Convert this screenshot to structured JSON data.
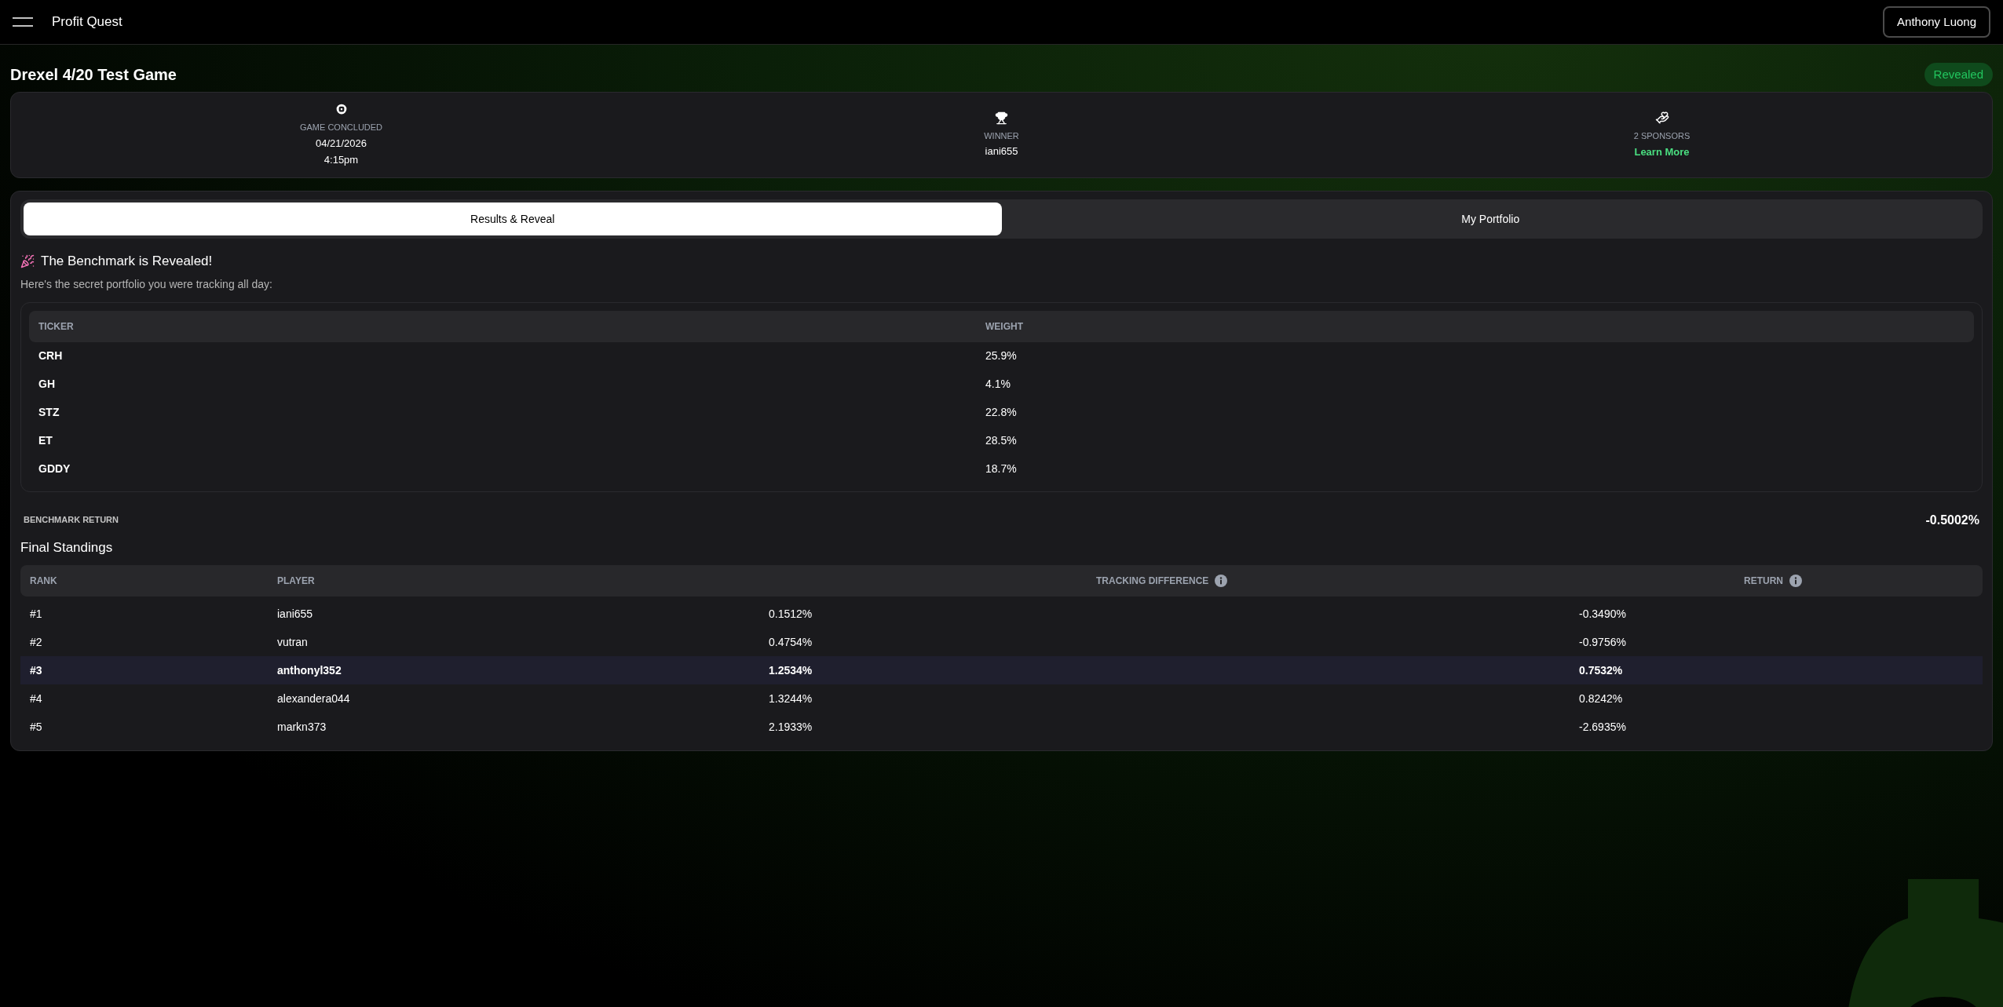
{
  "navbar": {
    "brand": "Profit Quest",
    "user_button": "Anthony Luong"
  },
  "game": {
    "title": "Drexel 4/20 Test Game",
    "status_badge": "Revealed"
  },
  "stats": [
    {
      "kind": "concluded",
      "label": "GAME CONCLUDED",
      "lines": [
        "04/21/2026",
        "4:15pm"
      ]
    },
    {
      "kind": "winner",
      "label": "WINNER",
      "lines": [
        "iani655"
      ]
    },
    {
      "kind": "sponsors",
      "label": "2 SPONSORS",
      "link": "Learn More"
    }
  ],
  "tabs": [
    {
      "label": "Results & Reveal",
      "selected": true
    },
    {
      "label": "My Portfolio",
      "selected": false
    }
  ],
  "reveal": {
    "heading": "The Benchmark is Revealed!",
    "subtitle": "Here's the secret portfolio you were tracking all day:"
  },
  "benchmark_table": {
    "columns": [
      "TICKER",
      "WEIGHT"
    ],
    "rows": [
      [
        "CRH",
        "25.9%"
      ],
      [
        "GH",
        "4.1%"
      ],
      [
        "STZ",
        "22.8%"
      ],
      [
        "ET",
        "28.5%"
      ],
      [
        "GDDY",
        "18.7%"
      ]
    ]
  },
  "benchmark_return": {
    "label": "BENCHMARK RETURN",
    "value": "-0.5002%"
  },
  "standings": {
    "title": "Final Standings",
    "columns": [
      {
        "label": "RANK",
        "info": false
      },
      {
        "label": "PLAYER",
        "info": false
      },
      {
        "label": "TRACKING DIFFERENCE",
        "info": true
      },
      {
        "label": "RETURN",
        "info": true
      }
    ],
    "rows": [
      {
        "rank": "#1",
        "player": "iani655",
        "tracking": "0.1512%",
        "return": "-0.3490%",
        "current_user": false
      },
      {
        "rank": "#2",
        "player": "vutran",
        "tracking": "0.4754%",
        "return": "-0.9756%",
        "current_user": false
      },
      {
        "rank": "#3",
        "player": "anthonyl352",
        "tracking": "1.2534%",
        "return": "0.7532%",
        "current_user": true
      },
      {
        "rank": "#4",
        "player": "alexandera044",
        "tracking": "1.3244%",
        "return": "0.8242%",
        "current_user": false
      },
      {
        "rank": "#5",
        "player": "markn373",
        "tracking": "2.1933%",
        "return": "-2.6935%",
        "current_user": false
      }
    ]
  }
}
